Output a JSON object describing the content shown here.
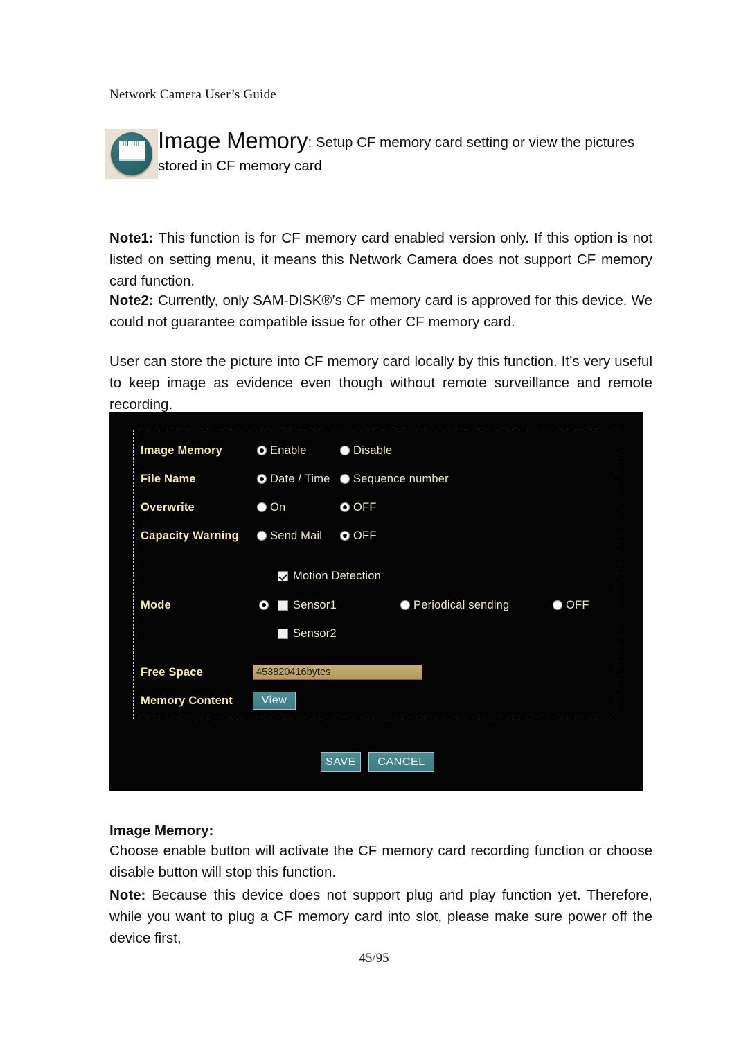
{
  "document": {
    "running_header": "Network Camera User’s Guide",
    "page_number": "45/95"
  },
  "title": {
    "icon": "cf-memory-card-icon",
    "heading": "Image Memory",
    "colon": ":",
    "description_line1": " Setup CF memory card setting or view the pictures",
    "description_line2": "stored in CF memory card"
  },
  "notes": {
    "note1_label": "Note1:",
    "note1_text": " This function is for CF memory card enabled version only. If this option is not listed on setting menu, it means this Network Camera does not support CF memory card function.",
    "note2_label": "Note2:",
    "note2_text": " Currently, only SAM-DISK®’s CF memory card is approved for this device. We could not guarantee compatible issue for other CF memory card.",
    "intro_text": "User can store the picture into CF memory card locally by this function. It’s very useful to keep image as evidence even though without remote surveillance and remote recording."
  },
  "screenshot": {
    "rows": {
      "image_memory": {
        "label": "Image Memory",
        "option1": "Enable",
        "option2": "Disable"
      },
      "file_name": {
        "label": "File Name",
        "option1": "Date / Time",
        "option2": "Sequence number"
      },
      "overwrite": {
        "label": "Overwrite",
        "option1": "On",
        "option2": "OFF"
      },
      "capacity_warning": {
        "label": "Capacity Warning",
        "option1": "Send Mail",
        "option2": "OFF"
      },
      "mode": {
        "label": "Mode",
        "motion_detection": "Motion Detection",
        "sensor1": "Sensor1",
        "sensor2": "Sensor2",
        "periodical_sending": "Periodical sending",
        "off": "OFF"
      },
      "free_space": {
        "label": "Free Space",
        "value": "453820416bytes"
      },
      "memory_content": {
        "label": "Memory Content",
        "button": "View"
      }
    },
    "buttons": {
      "save": "SAVE",
      "cancel": "CANCEL"
    },
    "colors": {
      "panel_background": "#040404",
      "label_text": "#f7e9b0",
      "option_text": "#f0e8cf",
      "input_fill": "#b59a60",
      "button_fill": "#3f7d84"
    }
  },
  "explanation": {
    "heading": "Image Memory:",
    "body": "Choose enable button will activate the CF memory card recording function or choose disable button will stop this function.",
    "note_label": "Note:",
    "note_text": " Because this device does not support plug and play function yet. Therefore, while you want to plug a CF memory card into slot, please make sure power off the device first,"
  }
}
